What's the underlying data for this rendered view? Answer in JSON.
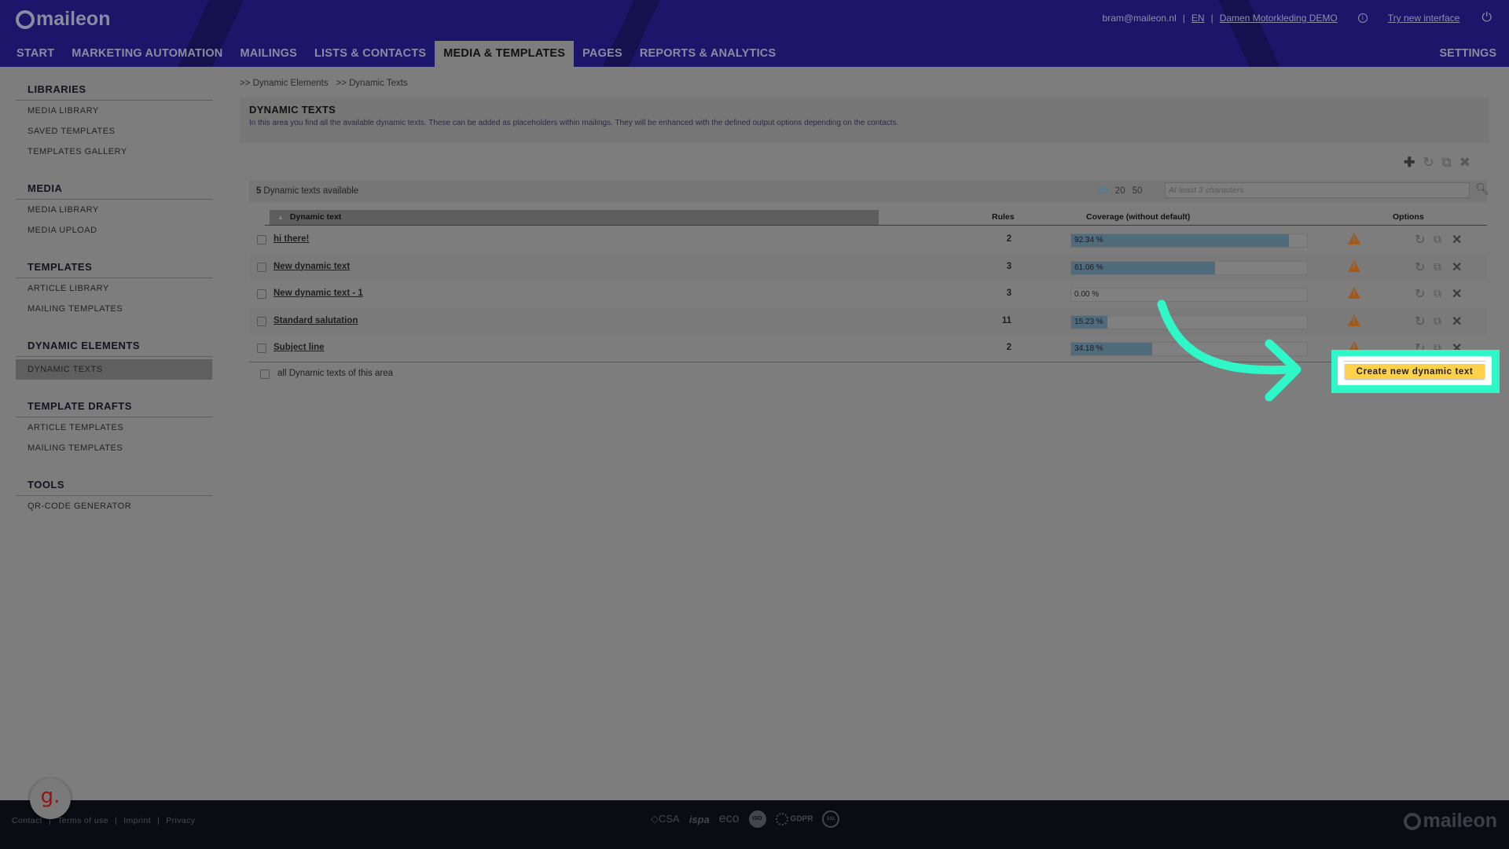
{
  "header": {
    "logo_text": "maileon",
    "user_email": "bram@maileon.nl",
    "language": "EN",
    "account": "Damen Motorkleding DEMO",
    "try_new_interface": "Try new interface",
    "nav": [
      {
        "label": "START",
        "active": false
      },
      {
        "label": "MARKETING AUTOMATION",
        "active": false
      },
      {
        "label": "MAILINGS",
        "active": false
      },
      {
        "label": "LISTS & CONTACTS",
        "active": false
      },
      {
        "label": "MEDIA & TEMPLATES",
        "active": true
      },
      {
        "label": "PAGES",
        "active": false
      },
      {
        "label": "REPORTS & ANALYTICS",
        "active": false
      }
    ],
    "settings": "SETTINGS"
  },
  "sidebar": {
    "groups": [
      {
        "title": "LIBRARIES",
        "items": [
          "MEDIA LIBRARY",
          "SAVED TEMPLATES",
          "TEMPLATES GALLERY"
        ]
      },
      {
        "title": "MEDIA",
        "items": [
          "MEDIA LIBRARY",
          "MEDIA UPLOAD"
        ]
      },
      {
        "title": "TEMPLATES",
        "items": [
          "ARTICLE LIBRARY",
          "MAILING TEMPLATES"
        ]
      },
      {
        "title": "DYNAMIC ELEMENTS",
        "items": [
          "DYNAMIC TEXTS"
        ],
        "active_item": "DYNAMIC TEXTS"
      },
      {
        "title": "TEMPLATE DRAFTS",
        "items": [
          "ARTICLE TEMPLATES",
          "MAILING TEMPLATES"
        ]
      },
      {
        "title": "TOOLS",
        "items": [
          "QR-CODE GENERATOR"
        ]
      }
    ]
  },
  "breadcrumb": [
    ">> Dynamic Elements",
    ">> Dynamic Texts"
  ],
  "intro": {
    "title": "DYNAMIC TEXTS",
    "description": "In this area you find all the available dynamic texts. These can be added as placeholders within mailings. They will be enhanced with the defined output options depending on the contacts."
  },
  "list": {
    "count": "5",
    "count_label": "Dynamic texts available",
    "page_sizes": [
      "10",
      "20",
      "50"
    ],
    "selected_page_size": "10",
    "search_placeholder": "At least 3 characters",
    "columns": {
      "name": "Dynamic text",
      "rules": "Rules",
      "coverage": "Coverage (without default)",
      "options": "Options"
    },
    "rows": [
      {
        "name": "hi there!",
        "rules": "2",
        "coverage": 92.34,
        "coverage_label": "92.34 %"
      },
      {
        "name": "New dynamic text",
        "rules": "3",
        "coverage": 61.06,
        "coverage_label": "61.06 %"
      },
      {
        "name": "New dynamic text - 1",
        "rules": "3",
        "coverage": 0.0,
        "coverage_label": "0.00 %"
      },
      {
        "name": "Standard salutation",
        "rules": "11",
        "coverage": 15.23,
        "coverage_label": "15.23 %"
      },
      {
        "name": "Subject line",
        "rules": "2",
        "coverage": 34.18,
        "coverage_label": "34.18 %"
      }
    ],
    "select_all_label": "all Dynamic texts of this area"
  },
  "create_button": "Create new dynamic text",
  "colors": {
    "header_bg": "#1b1669",
    "highlight": "#2ff7c7",
    "button": "#ffd14a",
    "bar_fill": "#4f6b7c",
    "warning": "#a35a19"
  },
  "footer": {
    "links": [
      "Contact",
      "Terms of use",
      "Imprint",
      "Privacy"
    ],
    "badges": [
      "CSA",
      "ispa",
      "eco",
      "ISO",
      "GDPR",
      "SSL"
    ],
    "logo_text": "maileon",
    "widget_letter": "g."
  }
}
